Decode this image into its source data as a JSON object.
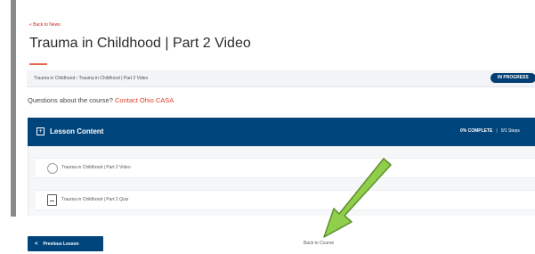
{
  "nav": {
    "back_link": "« Back to News"
  },
  "page": {
    "title": "Trauma in Childhood | Part 2 Video"
  },
  "breadcrumb": {
    "text": "Trauma in Childhood › Trauma in Childhood | Part 2 Video"
  },
  "status": {
    "label": "IN PROGRESS",
    "color": "#003e73"
  },
  "questions": {
    "prefix": "Questions about the course?",
    "link_label": "Contact Ohio CASA"
  },
  "lesson_content": {
    "header_label": "Lesson Content",
    "progress": "0% COMPLETE",
    "progress_percent": 0,
    "steps": "0/1 Steps",
    "items": [
      {
        "label": "Trauma in Childhood | Part 2 Video",
        "icon": "radio-circle-icon"
      },
      {
        "label": "Trauma in Childhood | Part 2 Quiz",
        "icon": "quiz-icon"
      }
    ]
  },
  "footer": {
    "prev_label": "Previous Lesson",
    "back_to_course": "Back to Course"
  },
  "annotation": {
    "arrow_color": "#8fcf4b",
    "arrow_stroke": "#5e8f2e"
  },
  "colors": {
    "accent": "#00447c",
    "link": "#e0402a",
    "back_link": "#c5221f"
  }
}
